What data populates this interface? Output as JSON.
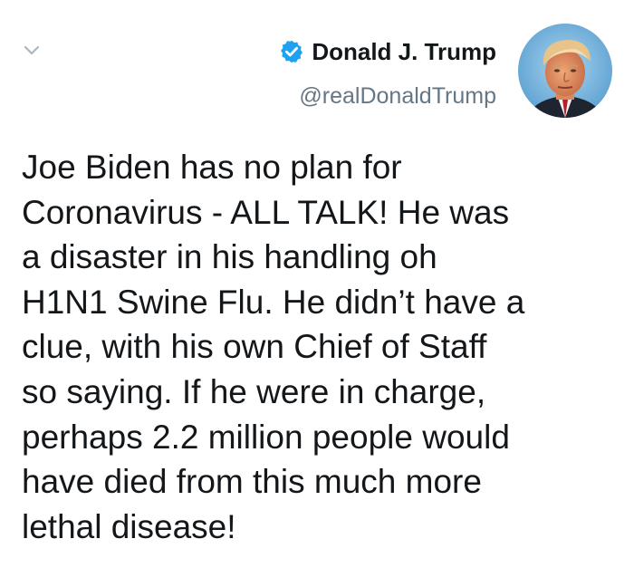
{
  "tweet": {
    "author": {
      "name": "Donald J. Trump",
      "handle": "@realDonaldTrump",
      "verified": true,
      "verified_color": "#1da1f2"
    },
    "icons": {
      "menu": "chevron-down-icon",
      "verified": "verified-badge-icon"
    },
    "text": "Joe Biden has no plan for\nCoronavirus - ALL TALK! He was\na disaster in his handling oh\nH1N1 Swine Flu. He didn’t have a\nclue, with his own Chief of Staff\nso saying. If he were in charge,\nperhaps 2.2 million people would\nhave died from this much more\nlethal disease!"
  }
}
